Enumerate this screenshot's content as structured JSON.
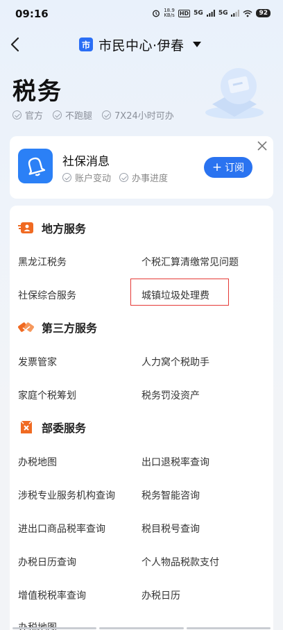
{
  "status_bar": {
    "time": "09:16",
    "net_speed_top": "18.9",
    "net_speed_bottom": "KB/s",
    "hd": "HD",
    "signal_1": "5G",
    "signal_2": "5G",
    "battery": "92"
  },
  "nav": {
    "logo_char": "市",
    "title": "市民中心·伊春"
  },
  "header": {
    "title": "税务",
    "tags": [
      "官方",
      "不跑腿",
      "7X24小时可办"
    ]
  },
  "subscribe": {
    "title": "社保消息",
    "tags": [
      "账户变动",
      "办事进度"
    ],
    "button": "订阅"
  },
  "sections": [
    {
      "title": "地方服务",
      "items": [
        "黑龙江税务",
        "个税汇算清缴常见问题",
        "社保综合服务",
        "城镇垃圾处理费"
      ]
    },
    {
      "title": "第三方服务",
      "items": [
        "发票管家",
        "人力窝个税助手",
        "家庭个税筹划",
        "税务罚没资产"
      ]
    },
    {
      "title": "部委服务",
      "items": [
        "办税地图",
        "出口退税率查询",
        "涉税专业服务机构查询",
        "税务智能咨询",
        "进出口商品税率查询",
        "税目税号查询",
        "办税日历查询",
        "个人物品税款支付",
        "增值税税率查询",
        "办税日历",
        "办税地图"
      ]
    }
  ],
  "colors": {
    "accent": "#2a73f0",
    "highlight": "#e53935",
    "section_icon": "#f06a22"
  }
}
